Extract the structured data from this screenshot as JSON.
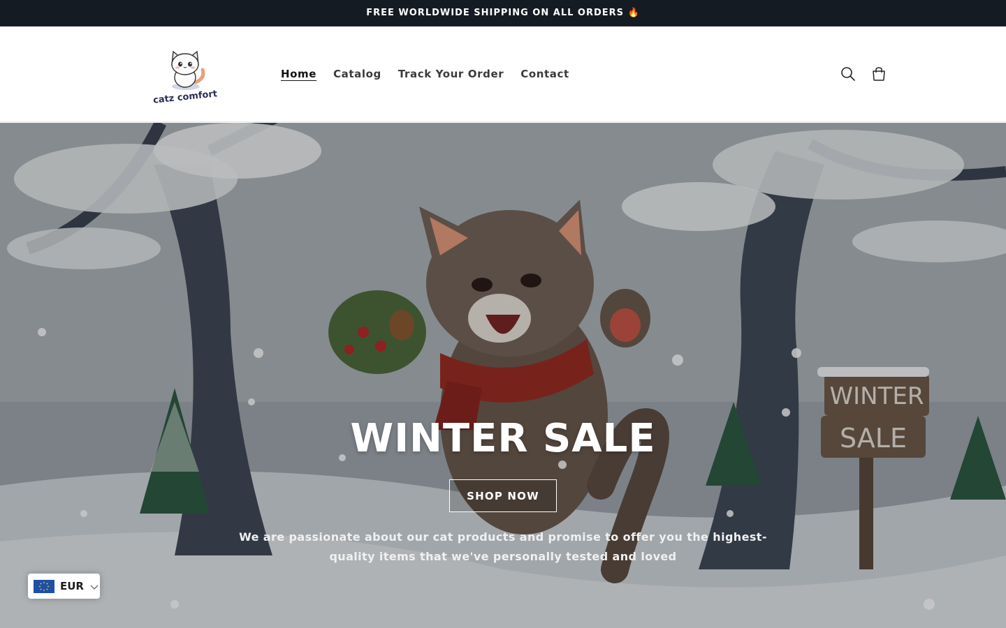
{
  "announcement": {
    "text": "FREE WORLDWIDE SHIPPING ON ALL ORDERS 🔥"
  },
  "header": {
    "logo_text": "catz comfort",
    "nav": [
      {
        "label": "Home",
        "active": true
      },
      {
        "label": "Catalog"
      },
      {
        "label": "Track Your Order"
      },
      {
        "label": "Contact"
      }
    ],
    "icons": [
      "search-icon",
      "cart-icon"
    ]
  },
  "hero": {
    "title": "WINTER SALE",
    "button_label": "SHOP NOW",
    "subtitle": "We are passionate about our cat products and promise to offer you the highest-quality items that we've personally tested and loved",
    "sign_line1": "WINTER",
    "sign_line2": "SALE"
  },
  "currency": {
    "code": "EUR",
    "flag": "eu-flag-icon"
  },
  "colors": {
    "announcement_bg": "#141b23",
    "accent": "#121212"
  }
}
